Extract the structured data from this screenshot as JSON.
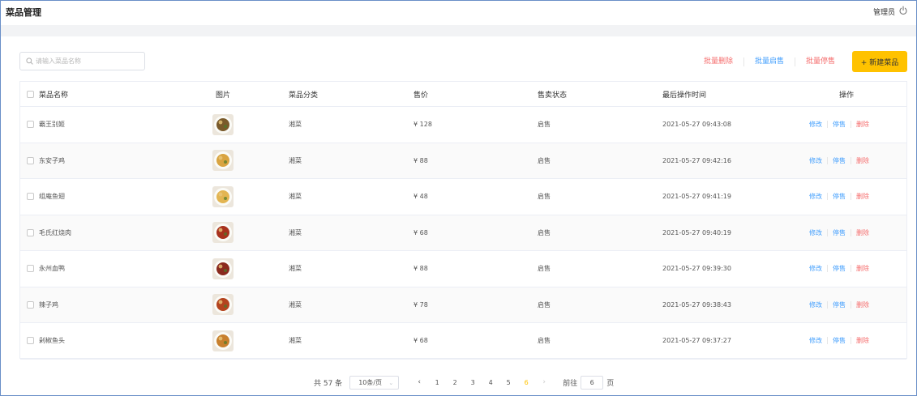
{
  "header": {
    "title": "菜品管理",
    "user": "管理员"
  },
  "toolbar": {
    "search_placeholder": "请输入菜品名称",
    "batch_delete": "批量删除",
    "batch_onsale": "批量启售",
    "batch_offsale": "批量停售",
    "new_dish": "+ 新建菜品"
  },
  "table": {
    "columns": [
      "菜品名称",
      "图片",
      "菜品分类",
      "售价",
      "售卖状态",
      "最后操作时间",
      "操作"
    ],
    "action_labels": {
      "edit": "修改",
      "stop": "停售",
      "delete": "删除"
    },
    "rows": [
      {
        "name": "霸王别姬",
        "category": "湘菜",
        "price": "¥ 128",
        "status": "启售",
        "updated": "2021-05-27 09:43:08",
        "img": "#7a5a2a"
      },
      {
        "name": "东安子鸡",
        "category": "湘菜",
        "price": "¥ 88",
        "status": "启售",
        "updated": "2021-05-27 09:42:16",
        "img": "#d9a441"
      },
      {
        "name": "组庵鱼翅",
        "category": "湘菜",
        "price": "¥ 48",
        "status": "启售",
        "updated": "2021-05-27 09:41:19",
        "img": "#e3b552"
      },
      {
        "name": "毛氏红烧肉",
        "category": "湘菜",
        "price": "¥ 68",
        "status": "启售",
        "updated": "2021-05-27 09:40:19",
        "img": "#a8321e"
      },
      {
        "name": "永州血鸭",
        "category": "湘菜",
        "price": "¥ 88",
        "status": "启售",
        "updated": "2021-05-27 09:39:30",
        "img": "#8a2a1e"
      },
      {
        "name": "辣子鸡",
        "category": "湘菜",
        "price": "¥ 78",
        "status": "启售",
        "updated": "2021-05-27 09:38:43",
        "img": "#b4441e"
      },
      {
        "name": "剁椒鱼头",
        "category": "湘菜",
        "price": "¥ 68",
        "status": "启售",
        "updated": "2021-05-27 09:37:27",
        "img": "#c8802e"
      }
    ]
  },
  "pagination": {
    "total_text": "共 57 条",
    "page_size": "10条/页",
    "pages": [
      "1",
      "2",
      "3",
      "4",
      "5",
      "6"
    ],
    "current": "6",
    "goto_label": "前往",
    "goto_value": "6",
    "page_suffix": "页"
  },
  "colors": {
    "accent": "#ffc200",
    "danger": "#f56c6c",
    "link": "#419efd"
  }
}
